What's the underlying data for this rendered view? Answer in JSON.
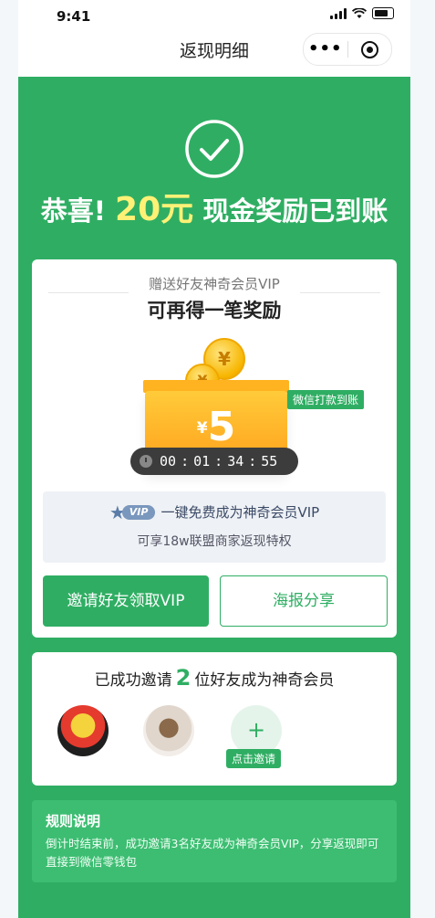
{
  "status_bar": {
    "time": "9:41"
  },
  "nav": {
    "title": "返现明细"
  },
  "hero": {
    "headline_prefix": "恭喜!",
    "amount": "20元",
    "headline_suffix": "现金奖励已到账"
  },
  "reward_card": {
    "subtitle": "赠送好友神奇会员VIP",
    "title": "可再得一笔奖励",
    "box_currency": "¥",
    "box_value": "5",
    "tag": "微信打款到账",
    "coin_symbol": "¥",
    "countdown": {
      "h": "00",
      "m": "01",
      "s": "34",
      "ms": "55"
    },
    "vip_badge": "VIP",
    "vip_text": "一键免费成为神奇会员VIP",
    "vip_sub": "可享18w联盟商家返现特权",
    "invite_button": "邀请好友领取VIP",
    "share_button": "海报分享"
  },
  "invite_card": {
    "title_prefix": "已成功邀请",
    "count": "2",
    "title_suffix": "位好友成为神奇会员",
    "add_icon": "+",
    "add_label": "点击邀请"
  },
  "rules": {
    "title": "规则说明",
    "text": "倒计时结束前，成功邀请3名好友成为神奇会员VIP，分享返现即可直接到微信零钱包"
  },
  "colors": {
    "primary": "#2fae63",
    "highlight": "#fff176"
  }
}
